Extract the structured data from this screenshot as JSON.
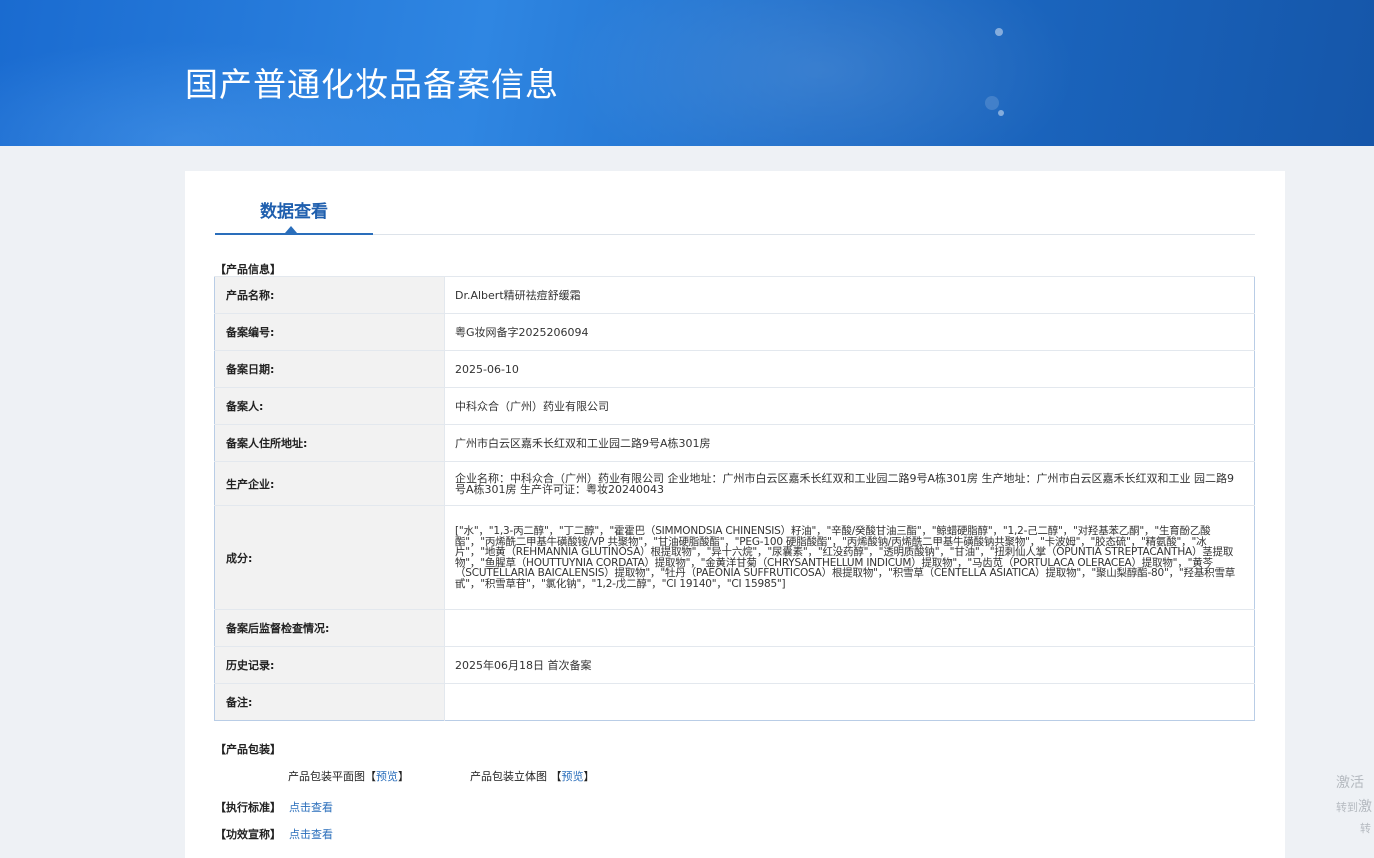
{
  "header": {
    "title": "国产普通化妆品备案信息"
  },
  "tabs": [
    {
      "label": "数据查看"
    }
  ],
  "product_info": {
    "section_label": "【产品信息】",
    "rows": [
      {
        "key": "产品名称:",
        "value": "Dr.Albert精研祛痘舒缓霜"
      },
      {
        "key": "备案编号:",
        "value": "粤G妆网备字2025206094"
      },
      {
        "key": "备案日期:",
        "value": "2025-06-10"
      },
      {
        "key": "备案人:",
        "value": "中科众合（广州）药业有限公司"
      },
      {
        "key": "备案人住所地址:",
        "value": "广州市白云区嘉禾长红双和工业园二路9号A栋301房"
      },
      {
        "key": "生产企业:",
        "value": "企业名称：中科众合（广州）药业有限公司 企业地址：广州市白云区嘉禾长红双和工业园二路9号A栋301房 生产地址：广州市白云区嘉禾长红双和工业 园二路9号A栋301房 生产许可证：粤妆20240043"
      },
      {
        "key": "成分:",
        "value": "[\"水\"，\"1,3-丙二醇\"，\"丁二醇\"，\"霍霍巴（SIMMONDSIA CHINENSIS）籽油\"，\"辛酸/癸酸甘油三酯\"，\"鲸蜡硬脂醇\"，\"1,2-己二醇\"，\"对羟基苯乙酮\"，\"生育酚乙酸酯\"，\"丙烯酰二甲基牛磺酸铵/VP 共聚物\"，\"甘油硬脂酸酯\"，\"PEG-100 硬脂酸酯\"，\"丙烯酸钠/丙烯酰二甲基牛磺酸钠共聚物\"，\"卡波姆\"，\"胶态硫\"，\"精氨酸\"，\"冰片\"，\"地黄（REHMANNIA GLUTINOSA）根提取物\"，\"异十六烷\"，\"尿囊素\"，\"红没药醇\"，\"透明质酸钠\"，\"甘油\"，\"扭刺仙人掌（OPUNTIA STREPTACANTHA）茎提取物\"，\"鱼腥草（HOUTTUYNIA CORDATA）提取物\"，\"金黄洋甘菊（CHRYSANTHELLUM INDICUM）提取物\"，\"马齿苋（PORTULACA OLERACEA）提取物\"，\"黄芩（SCUTELLARIA BAICALENSIS）提取物\"，\"牡丹（PAEONIA SUFFRUTICOSA）根提取物\"，\"积雪草（CENTELLA ASIATICA）提取物\"，\"聚山梨醇酯-80\"，\"羟基积雪草甙\"，\"积雪草苷\"，\"氯化钠\"，\"1,2-戊二醇\"，\"CI 19140\"，\"CI 15985\"]"
      },
      {
        "key": "备案后监督检查情况:",
        "value": ""
      },
      {
        "key": "历史记录:",
        "value": "2025年06月18日 首次备案"
      },
      {
        "key": "备注:",
        "value": ""
      }
    ]
  },
  "packaging": {
    "section_label": "【产品包装】",
    "flat_label": "产品包装平面图",
    "solid_label": "产品包装立体图",
    "bracket_open": "【",
    "bracket_close": "】",
    "preview_link": "预览"
  },
  "standard": {
    "label": "【执行标准】",
    "link": "点击查看"
  },
  "efficacy": {
    "label": "【功效宣称】",
    "link": "点击查看"
  },
  "watermark": {
    "line1": "激活",
    "line2": "转到",
    "line2_tail": "激",
    "line3": "转"
  }
}
